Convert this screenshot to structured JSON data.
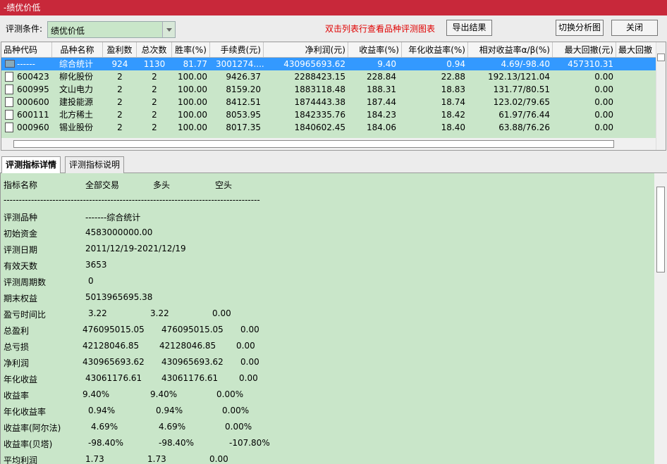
{
  "window": {
    "title": "-绩优价低"
  },
  "toolbar": {
    "condition_label": "评测条件:",
    "condition_value": "绩优价低",
    "hint": "双击列表行查看品种评测图表",
    "export_label": "导出结果",
    "switch_label": "切换分析图",
    "close_label": "关闭"
  },
  "table": {
    "columns": [
      "品种代码",
      "品种名称",
      "盈利数",
      "总次数",
      "胜率(%)",
      "手续费(元)",
      "净利润(元)",
      "收益率(%)",
      "年化收益率(%)",
      "相对收益率α/β(%)",
      "最大回撤(元)",
      "最大回撤"
    ],
    "rows": [
      {
        "code": "------",
        "name": "综合统计",
        "wins": "924",
        "total": "1130",
        "win_rate": "81.77",
        "fee": "3001274....",
        "net": "430965693.62",
        "ret": "9.40",
        "ann": "0.94",
        "rel": "4.69/-98.40",
        "dd": "457310.31"
      },
      {
        "code": "600423",
        "name": "柳化股份",
        "wins": "2",
        "total": "2",
        "win_rate": "100.00",
        "fee": "9426.37",
        "net": "2288423.15",
        "ret": "228.84",
        "ann": "22.88",
        "rel": "192.13/121.04",
        "dd": "0.00"
      },
      {
        "code": "600995",
        "name": "文山电力",
        "wins": "2",
        "total": "2",
        "win_rate": "100.00",
        "fee": "8159.20",
        "net": "1883118.48",
        "ret": "188.31",
        "ann": "18.83",
        "rel": "131.77/80.51",
        "dd": "0.00"
      },
      {
        "code": "000600",
        "name": "建投能源",
        "wins": "2",
        "total": "2",
        "win_rate": "100.00",
        "fee": "8412.51",
        "net": "1874443.38",
        "ret": "187.44",
        "ann": "18.74",
        "rel": "123.02/79.65",
        "dd": "0.00"
      },
      {
        "code": "600111",
        "name": "北方稀土",
        "wins": "2",
        "total": "2",
        "win_rate": "100.00",
        "fee": "8053.95",
        "net": "1842335.76",
        "ret": "184.23",
        "ann": "18.42",
        "rel": "61.97/76.44",
        "dd": "0.00"
      },
      {
        "code": "000960",
        "name": "锡业股份",
        "wins": "2",
        "total": "2",
        "win_rate": "100.00",
        "fee": "8017.35",
        "net": "1840602.45",
        "ret": "184.06",
        "ann": "18.40",
        "rel": "63.88/76.26",
        "dd": "0.00"
      }
    ]
  },
  "tabs": {
    "detail": "评测指标详情",
    "explain": "评测指标说明"
  },
  "detail": {
    "header": {
      "name": "指标名称",
      "all": "全部交易",
      "long": "多头",
      "short": "空头"
    },
    "separator": "------------------------------------------------------------------------------------",
    "lines": [
      {
        "label": "评测品种",
        "v1": "-------综合统计",
        "v2": "",
        "v3": ""
      },
      {
        "label": "初始资金",
        "v1": "4583000000.00",
        "v2": "",
        "v3": ""
      },
      {
        "label": "评测日期",
        "v1": "2011/12/19-2021/12/19",
        "v2": "",
        "v3": ""
      },
      {
        "label": "有效天数",
        "v1": "3653",
        "v2": "",
        "v3": ""
      },
      {
        "label": "评测周期数",
        "v1": "0",
        "v2": "",
        "v3": ""
      },
      {
        "label": "期末权益",
        "v1": "5013965695.38",
        "v2": "",
        "v3": ""
      },
      {
        "label": "盈亏时间比",
        "v1": "3.22",
        "v2": "3.22",
        "v3": "0.00"
      },
      {
        "label": "总盈利",
        "v1": "476095015.05",
        "v2": "476095015.05",
        "v3": "0.00"
      },
      {
        "label": "总亏损",
        "v1": "42128046.85",
        "v2": "42128046.85",
        "v3": "0.00"
      },
      {
        "label": "净利润",
        "v1": "430965693.62",
        "v2": "430965693.62",
        "v3": "0.00"
      },
      {
        "label": "年化收益",
        "v1": "43061176.61",
        "v2": "43061176.61",
        "v3": "0.00"
      },
      {
        "label": "收益率",
        "v1": "9.40%",
        "v2": "9.40%",
        "v3": "0.00%"
      },
      {
        "label": "年化收益率",
        "v1": "0.94%",
        "v2": "0.94%",
        "v3": "0.00%"
      },
      {
        "label": "收益率(阿尔法)",
        "v1": "4.69%",
        "v2": "4.69%",
        "v3": "0.00%"
      },
      {
        "label": "收益率(贝塔)",
        "v1": "-98.40%",
        "v2": "-98.40%",
        "v3": "-107.80%"
      },
      {
        "label": "平均利润",
        "v1": "1.73",
        "v2": "1.73",
        "v3": "0.00"
      }
    ]
  }
}
